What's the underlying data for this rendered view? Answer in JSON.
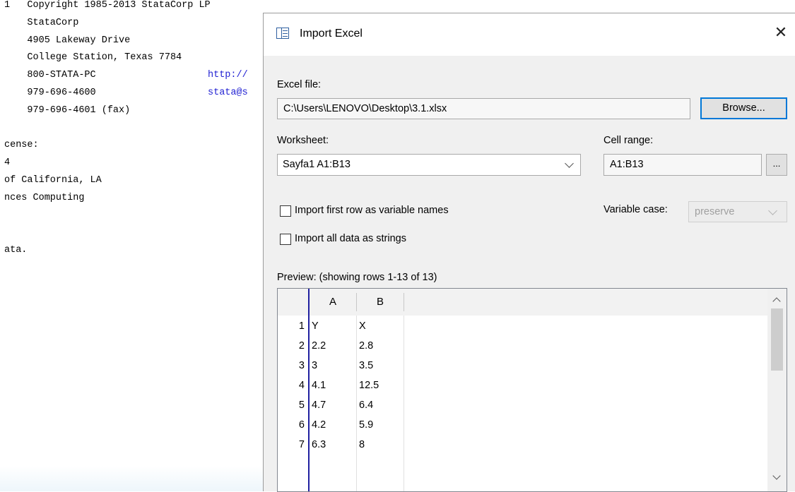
{
  "console": {
    "lines": [
      {
        "text": "1   Copyright 1985-2013 StataCorp LP"
      },
      {
        "text": "    StataCorp"
      },
      {
        "text": "    4905 Lakeway Drive"
      },
      {
        "text": "    College Station, Texas 7784"
      },
      {
        "text": "    800-STATA-PC",
        "link": "http://"
      },
      {
        "text": "    979-696-4600",
        "link": "stata@s"
      },
      {
        "text": "    979-696-4601 (fax)"
      },
      {
        "text": ""
      },
      {
        "text": "cense:"
      },
      {
        "text": "4"
      },
      {
        "text": "of California, LA"
      },
      {
        "text": "nces Computing"
      },
      {
        "text": ""
      },
      {
        "text": ""
      },
      {
        "text": "ata."
      }
    ],
    "link_color": "#1f1fd2"
  },
  "dialog": {
    "title": "Import Excel",
    "close_symbol": "✕",
    "excel_file_label": "Excel file:",
    "excel_file_value": "C:\\Users\\LENOVO\\Desktop\\3.1.xlsx",
    "browse_label": "Browse...",
    "worksheet_label": "Worksheet:",
    "worksheet_value": "Sayfa1 A1:B13",
    "cell_range_label": "Cell range:",
    "cell_range_value": "A1:B13",
    "range_button_label": "...",
    "first_row_label": "Import first row as variable names",
    "first_row_checked": false,
    "all_strings_label": "Import all data as strings",
    "all_strings_checked": false,
    "variable_case_label": "Variable case:",
    "variable_case_value": "preserve",
    "variable_case_disabled": true,
    "preview_label": "Preview: (showing rows 1-13 of 13)",
    "accent_color": "#0078d7"
  },
  "preview": {
    "columns": [
      "A",
      "B"
    ],
    "rows": [
      {
        "num": "1",
        "a": "Y",
        "b": "X"
      },
      {
        "num": "2",
        "a": "2.2",
        "b": "2.8"
      },
      {
        "num": "3",
        "a": "3",
        "b": "3.5"
      },
      {
        "num": "4",
        "a": "4.1",
        "b": "12.5"
      },
      {
        "num": "5",
        "a": "4.7",
        "b": "6.4"
      },
      {
        "num": "6",
        "a": "4.2",
        "b": "5.9"
      },
      {
        "num": "7",
        "a": "6.3",
        "b": "8"
      }
    ]
  }
}
